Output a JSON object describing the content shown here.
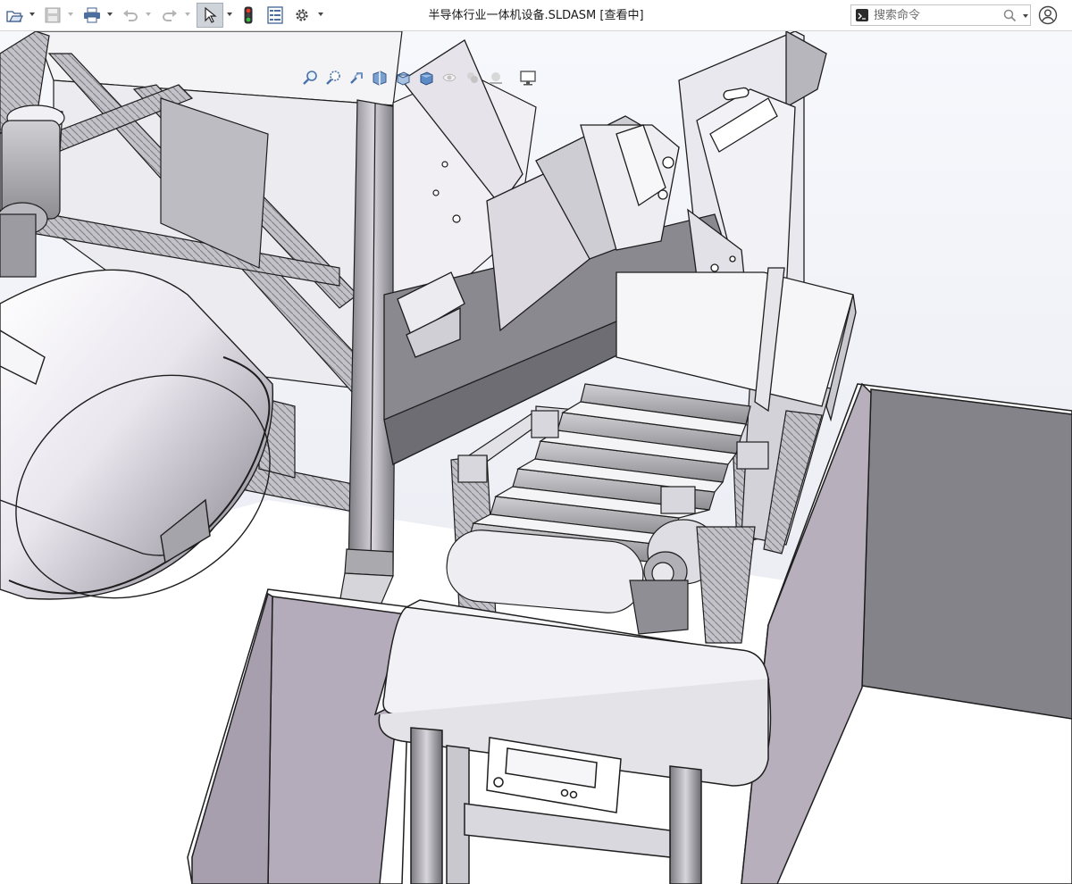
{
  "app": {
    "document_title": "半导体行业一体机设备.SLDASM [查看中]"
  },
  "search": {
    "placeholder": "搜索命令"
  },
  "toolbar": {
    "icons": [
      "open-icon",
      "save-icon",
      "print-icon",
      "undo-icon",
      "redo-icon",
      "select-icon",
      "traffic-light-icon",
      "file-properties-icon",
      "options-gear-icon"
    ]
  },
  "heads_up": {
    "icons": [
      "zoom-to-fit-icon",
      "zoom-to-area-icon",
      "previous-view-icon",
      "section-view-icon",
      "view-orientation-icon",
      "display-style-icon",
      "hide-show-items-icon",
      "edit-appearance-icon",
      "apply-scene-icon",
      "view-settings-icon"
    ]
  },
  "colors": {
    "viewport_bg_top": "#f6f7fb",
    "viewport_bg_bottom": "#e4e6ee",
    "model_face_light": "#f5f3f7",
    "model_face_mid": "#c9c4ce",
    "model_face_dark": "#7d7d82",
    "bin_inner": "#b5acbb"
  }
}
